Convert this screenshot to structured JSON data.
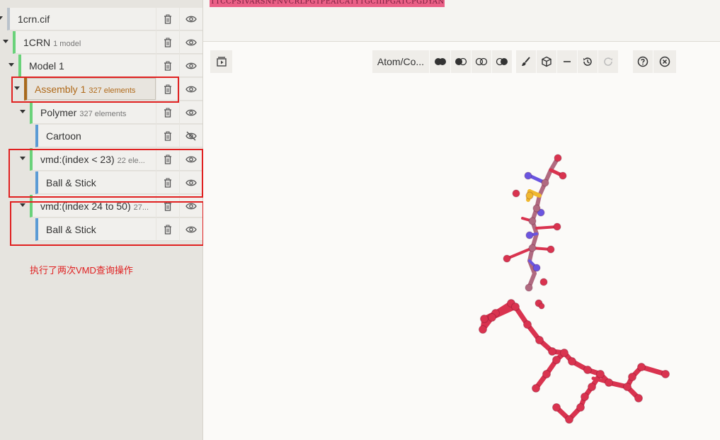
{
  "tree": [
    {
      "label": "1crn.cif",
      "sub": "",
      "expanded": true
    },
    {
      "label": "1CRN",
      "sub": "1 model",
      "expanded": true
    },
    {
      "label": "Model 1",
      "sub": "",
      "expanded": true
    },
    {
      "label": "Assembly 1",
      "sub": "327 elements",
      "expanded": true,
      "selected": true
    },
    {
      "label": "Polymer",
      "sub": "327 elements",
      "expanded": true
    },
    {
      "label": "Cartoon",
      "sub": "",
      "hidden": true
    },
    {
      "label": "vmd:(index < 23)",
      "sub": "22 ele...",
      "expanded": true
    },
    {
      "label": "Ball & Stick",
      "sub": ""
    },
    {
      "label": "vmd:(index 24 to 50)",
      "sub": "27...",
      "expanded": true
    },
    {
      "label": "Ball & Stick",
      "sub": ""
    }
  ],
  "annotation_text": "执行了两次VMD查询操作",
  "sequence": "TTCCPSIVARSNFNVCRLPGTPEAICATYTGCIIIPGATCPGDYAN",
  "toolbar": {
    "representation_label": "Atom/Co...",
    "buttons": [
      "play-icon",
      "overlay-both-icon",
      "overlay-left-icon",
      "overlay-none-icon",
      "overlay-right-icon",
      "brush-icon",
      "cube-icon",
      "minus-icon",
      "history-icon",
      "redo-icon",
      "help-icon",
      "close-icon"
    ]
  },
  "colors": {
    "accent_green": "#6ad27a",
    "accent_blue": "#5b9bd5",
    "selected_orange": "#a8691c",
    "annotation_red": "#e02020",
    "atom_red": "#d9334f",
    "atom_mauve": "#b06a80",
    "atom_blue": "#6a55e0",
    "atom_yellow": "#f0b830"
  }
}
